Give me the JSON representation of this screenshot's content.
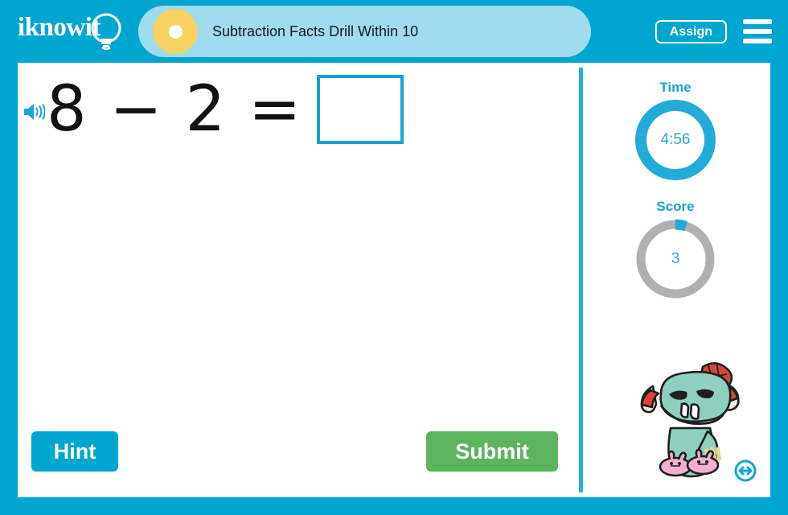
{
  "app": {
    "brand_name": "iknowit",
    "frame_color": "#00a5d0",
    "accent_color": "#13a4d4",
    "title_pill_color": "#9edcee",
    "dot_color": "#f6d263",
    "submit_color": "#5cb45c"
  },
  "header": {
    "lesson_title": "Subtraction Facts Drill Within 10",
    "assign_label": "Assign",
    "menu_icon": "hamburger-menu-icon",
    "status_dot_icon": "progress-dot-icon",
    "logo_icon": "lightbulb-icon"
  },
  "problem": {
    "speaker_icon": "speaker-audio-icon",
    "equation": "8 − 2 =",
    "operand_left": "8",
    "operator": "−",
    "operand_right": "2",
    "equals": "=",
    "answer_value": "",
    "answer_placeholder": ""
  },
  "sidebar": {
    "time": {
      "label": "Time",
      "value": "4:56",
      "ring_percent": 100,
      "ring_color": "#22abd8",
      "track_color": "#22abd8"
    },
    "score": {
      "label": "Score",
      "value": "3",
      "ring_percent": 5,
      "ring_color": "#22abd8",
      "track_color": "#b0b0b0"
    },
    "mascot_icon": "monster-mascot-icon",
    "resize_icon": "resize-horizontal-icon"
  },
  "actions": {
    "hint_label": "Hint",
    "submit_label": "Submit"
  }
}
